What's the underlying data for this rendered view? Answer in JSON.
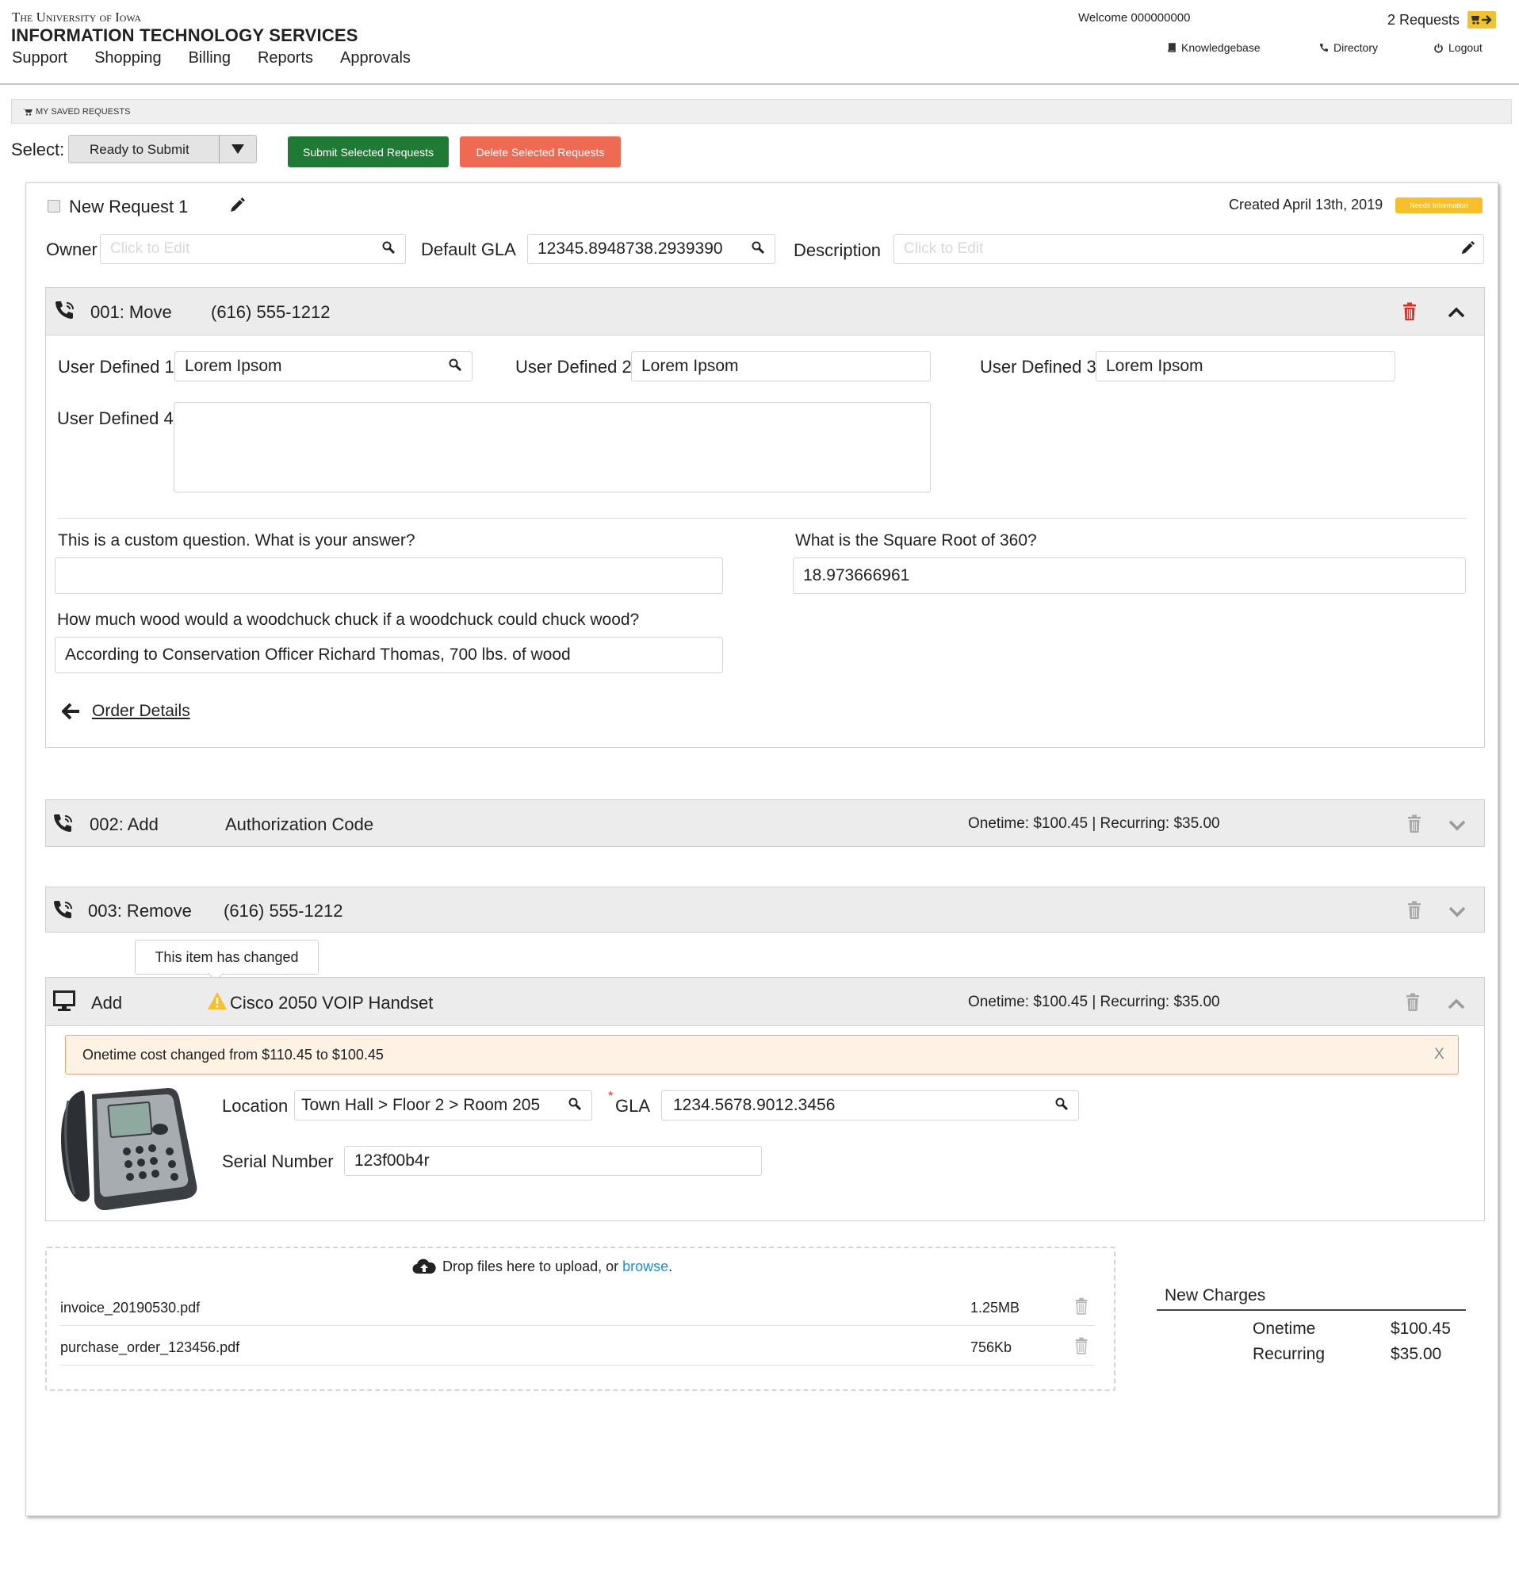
{
  "header": {
    "university": "The University of Iowa",
    "department": "INFORMATION TECHNOLOGY SERVICES",
    "nav": [
      "Support",
      "Shopping",
      "Billing",
      "Reports",
      "Approvals"
    ],
    "welcome": "Welcome 000000000",
    "requests_count": "2 Requests",
    "links": {
      "knowledgebase": "Knowledgebase",
      "directory": "Directory",
      "logout": "Logout"
    }
  },
  "section_title": "MY SAVED REQUESTS",
  "toolbar": {
    "select_label": "Select:",
    "select_value": "Ready to Submit",
    "submit_label": "Submit Selected Requests",
    "delete_label": "Delete Selected Requests"
  },
  "request": {
    "name": "New Request 1",
    "created": "Created April 13th, 2019",
    "badge": "Needs Information",
    "owner_label": "Owner",
    "owner_placeholder": "Click to Edit",
    "gla_label": "Default GLA",
    "gla_value": "12345.8948738.2939390",
    "description_label": "Description",
    "description_placeholder": "Click to Edit"
  },
  "item1": {
    "title": "001: Move",
    "phone": "(616) 555-1212",
    "ud1_label": "User Defined 1",
    "ud1_value": "Lorem Ipsom",
    "ud2_label": "User Defined 2",
    "ud2_value": "Lorem Ipsom",
    "ud3_label": "User Defined 3",
    "ud3_value": "Lorem Ipsom",
    "ud4_label": "User Defined 4",
    "ud4_value": "",
    "q1_label": "This is a custom question.  What is your answer?",
    "q1_value": "",
    "q2_label": "What is the Square Root of 360?",
    "q2_value": "18.973666961",
    "q3_label": "How much wood would a woodchuck chuck if a woodchuck could chuck wood?",
    "q3_value": "According to Conservation Officer Richard Thomas, 700 lbs. of wood",
    "order_details": "Order Details"
  },
  "item2": {
    "title": "002:  Add",
    "name": "Authorization Code",
    "cost": "Onetime: $100.45 | Recurring: $35.00"
  },
  "item3": {
    "title": "003:  Remove",
    "phone": "(616) 555-1212"
  },
  "tooltip": "This item has changed",
  "item4": {
    "title": "Add",
    "name": "Cisco 2050 VOIP Handset",
    "cost": "Onetime: $100.45 | Recurring: $35.00",
    "alert": "Onetime cost changed from $110.45 to $100.45",
    "alert_close": "X",
    "location_label": "Location",
    "location_value": "Town Hall > Floor 2 > Room 205",
    "gla_required": "*",
    "gla_label": "GLA",
    "gla_value": "1234.5678.9012.3456",
    "serial_label": "Serial Number",
    "serial_value": "123f00b4r"
  },
  "upload": {
    "prompt": "Drop files here to upload, or",
    "browse": "browse",
    "period": ".",
    "files": [
      {
        "name": "invoice_20190530.pdf",
        "size": "1.25MB"
      },
      {
        "name": "purchase_order_123456.pdf",
        "size": "756Kb"
      }
    ]
  },
  "charges": {
    "title": "New Charges",
    "onetime_label": "Onetime",
    "onetime_value": "$100.45",
    "recurring_label": "Recurring",
    "recurring_value": "$35.00"
  },
  "colors": {
    "submit": "#1e7a34",
    "delete": "#ef6a53",
    "badge": "#f6c02c",
    "alert_bg": "#fdf2e4",
    "alert_border": "#eaa27a",
    "trash_active": "#d9312a"
  }
}
